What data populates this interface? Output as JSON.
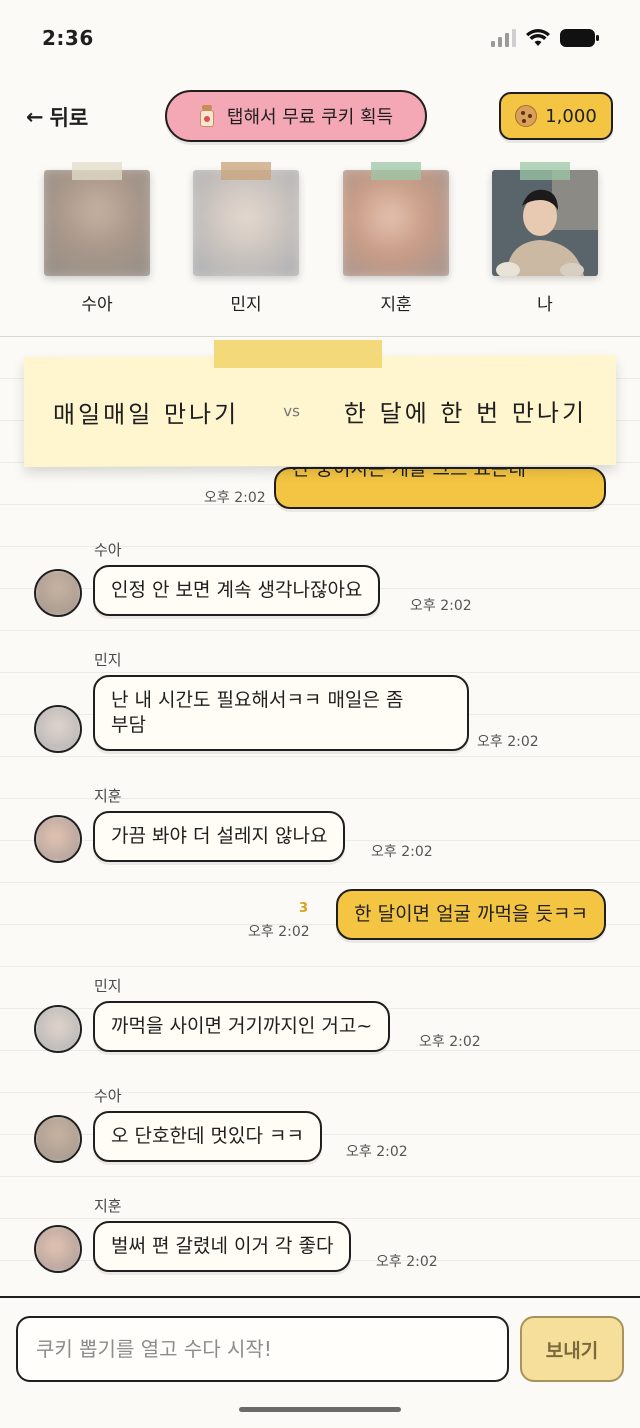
{
  "status": {
    "time": "2:36"
  },
  "header": {
    "back_label": "뒤로",
    "back_arrow": "←",
    "free_cookie_label": "탭해서 무료 쿠키 획득",
    "cookie_count": "1,000"
  },
  "profiles": [
    {
      "name": "수아"
    },
    {
      "name": "민지"
    },
    {
      "name": "지훈"
    },
    {
      "name": "나"
    }
  ],
  "topic": {
    "option_a": "매일매일 만나기",
    "vs": "vs",
    "option_b": "한 달에 한 번 만나기"
  },
  "messages": [
    {
      "sender": "",
      "text": "간 중이시는 게을 그드 요는데",
      "time": "오후 2:02",
      "mine": true
    },
    {
      "sender": "수아",
      "text": "인정 안 보면 계속 생각나잖아요",
      "time": "오후 2:02",
      "mine": false
    },
    {
      "sender": "민지",
      "text": "난 내 시간도 필요해서ㅋㅋ 매일은 좀\n부담",
      "time": "오후 2:02",
      "mine": false
    },
    {
      "sender": "지훈",
      "text": "가끔 봐야 더 설레지 않나요",
      "time": "오후 2:02",
      "mine": false
    },
    {
      "sender": "",
      "text": "한 달이면 얼굴 까먹을 듯ㅋㅋ",
      "time": "오후 2:02",
      "mine": true,
      "unread": "3"
    },
    {
      "sender": "민지",
      "text": "까먹을 사이면 거기까지인 거고~",
      "time": "오후 2:02",
      "mine": false
    },
    {
      "sender": "수아",
      "text": "오 단호한데 멋있다 ㅋㅋ",
      "time": "오후 2:02",
      "mine": false
    },
    {
      "sender": "지훈",
      "text": "벌써 편 갈렸네 이거 각 좋다",
      "time": "오후 2:02",
      "mine": false
    }
  ],
  "input": {
    "placeholder": "쿠키 뽑기를 열고 수다 시작!",
    "send_label": "보내기"
  },
  "colors": {
    "accent_yellow": "#f4c542",
    "pink": "#f4a8b6",
    "note": "#fff5cf",
    "background": "#fbfaf6"
  }
}
